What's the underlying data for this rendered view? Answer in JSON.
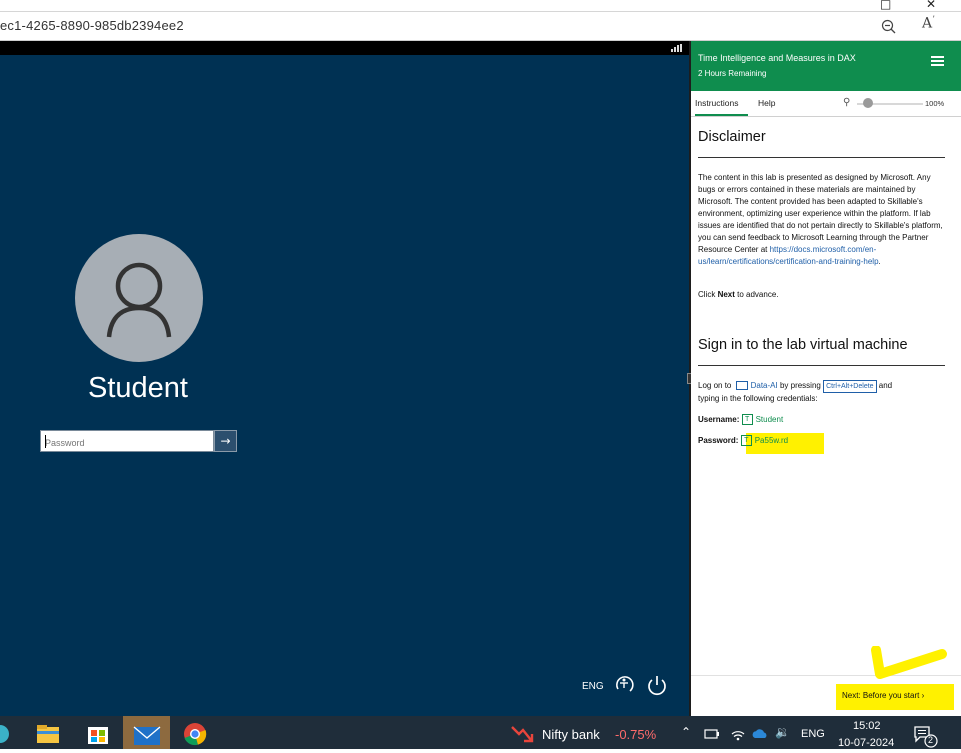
{
  "browser": {
    "address_text": "ec1-4265-8890-985db2394ee2",
    "zoom_out_icon": "zoom-out-icon",
    "read_aloud_icon": "read-aloud-icon"
  },
  "vm": {
    "user_name": "Student",
    "password_placeholder": "Password",
    "lang": "ENG",
    "background_color": "#003153"
  },
  "panel": {
    "title": "Time Intelligence and Measures in DAX",
    "remaining": "2 Hours Remaining",
    "brand_color": "#0f8d4e",
    "tabs": [
      {
        "label": "Instructions",
        "active": true
      },
      {
        "label": "Help",
        "active": false
      }
    ],
    "zoom": "100%",
    "disclaimer": {
      "heading": "Disclaimer",
      "body": "The content in this lab is presented as designed by Microsoft. Any bugs or errors contained in these materials are maintained by Microsoft. The content provided has been adapted to Skillable's environment, optimizing user experience within the platform. If lab issues are identified that do not pertain directly to Skillable's platform, you can send feedback to Microsoft Learning through the Partner Resource Center at ",
      "link": "https://docs.microsoft.com/en-us/learn/certifications/certification-and-training-help",
      "link_end": ".",
      "click_prefix": "Click ",
      "click_bold": "Next",
      "click_suffix": " to advance."
    },
    "signin": {
      "heading": "Sign in to the lab virtual machine",
      "logon_prefix": "Log on to ",
      "vm_name": "Data-AI",
      "pressing": " by pressing ",
      "key_combo": "Ctrl+Alt+Delete",
      "and": " and",
      "typing": "typing in the following credentials:",
      "username_label": "Username:",
      "username_value": "Student",
      "password_label": "Password:",
      "password_value": "Pa55w.rd"
    },
    "next_button": "Next: Before you start"
  },
  "taskbar": {
    "ticker_name": "Nifty bank",
    "ticker_change": "-0.75%",
    "lang": "ENG",
    "time": "15:02",
    "date": "10-07-2024",
    "notification_count": "2"
  }
}
